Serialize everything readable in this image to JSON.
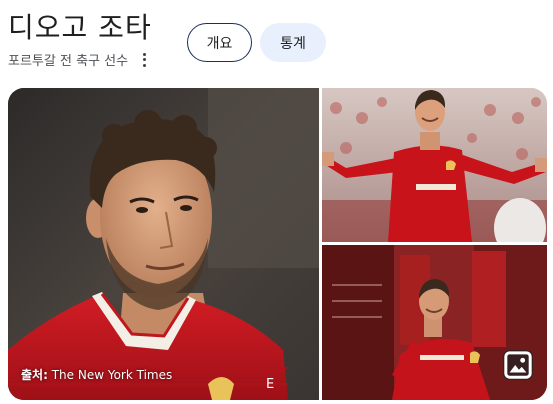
{
  "entity": {
    "title": "디오고 조타",
    "subtitle": "포르투갈 전 축구 선수",
    "more_icon": "vertical-dots-icon"
  },
  "chips": {
    "overview_label": "개요",
    "stats_label": "통계"
  },
  "images": {
    "source_label": "출처:",
    "source_name": "The New York Times",
    "badge_icon": "image-icon",
    "shirt_brand": "E",
    "colors": {
      "kit_red": "#c0161e",
      "chip_outline": "#1a2f5f",
      "chip_fill": "#e8f0fe"
    }
  }
}
